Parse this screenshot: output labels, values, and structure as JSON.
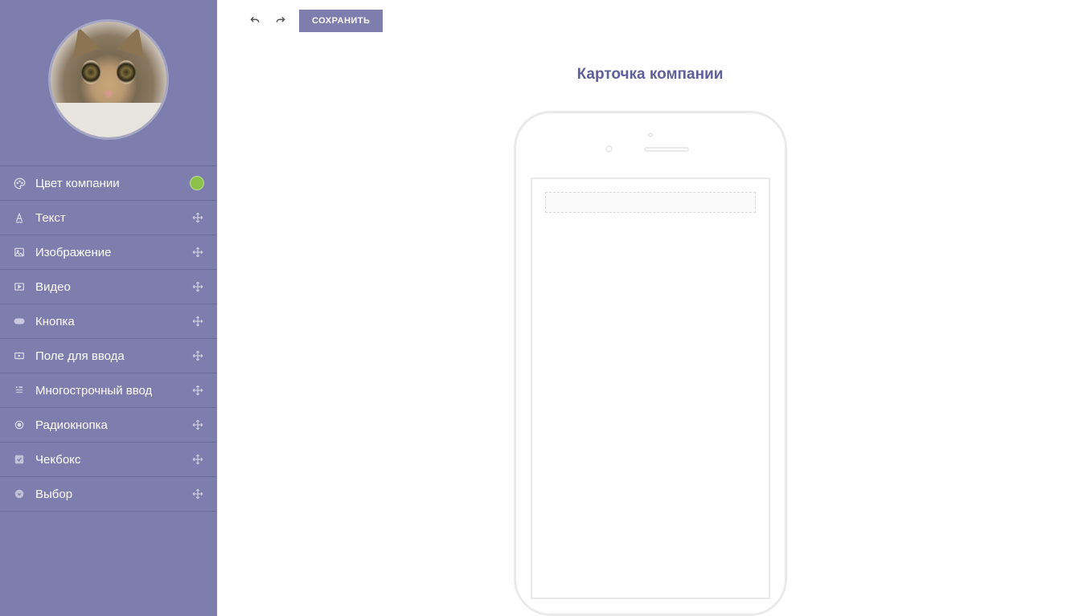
{
  "sidebar": {
    "items": [
      {
        "label": "Цвет компании",
        "icon": "palette",
        "right": "color-dot"
      },
      {
        "label": "Текст",
        "icon": "text-underline",
        "right": "drag"
      },
      {
        "label": "Изображение",
        "icon": "image",
        "right": "drag"
      },
      {
        "label": "Видео",
        "icon": "video",
        "right": "drag"
      },
      {
        "label": "Кнопка",
        "icon": "button",
        "right": "drag"
      },
      {
        "label": "Поле для ввода",
        "icon": "input",
        "right": "drag"
      },
      {
        "label": "Многострочный ввод",
        "icon": "textarea",
        "right": "drag"
      },
      {
        "label": "Радиокнопка",
        "icon": "radio",
        "right": "drag"
      },
      {
        "label": "Чекбокс",
        "icon": "checkbox",
        "right": "drag"
      },
      {
        "label": "Выбор",
        "icon": "select",
        "right": "drag"
      }
    ]
  },
  "toolbar": {
    "save_label": "СОХРАНИТЬ"
  },
  "canvas": {
    "title": "Карточка компании"
  },
  "colors": {
    "company_color": "#8bc34a",
    "sidebar_bg": "#7d7eae",
    "accent_text": "#5f5f9a"
  }
}
